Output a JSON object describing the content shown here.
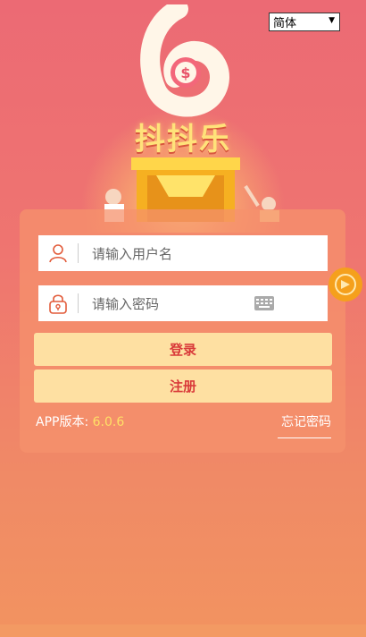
{
  "language_select": {
    "value": "简体"
  },
  "brand": {
    "title": "抖抖乐"
  },
  "login_form": {
    "username_placeholder": "请输入用户名",
    "password_placeholder": "请输入密码",
    "login_label": "登录",
    "register_label": "注册"
  },
  "footer": {
    "version_label": "APP版本:",
    "version_value": "6.0.6",
    "forgot_label": "忘记密码"
  },
  "icons": {
    "user": "user-icon",
    "lock": "lock-icon",
    "keyboard": "keyboard-icon",
    "side_arrow": "arrow-right-icon"
  },
  "colors": {
    "accent": "#fee0a2",
    "button_text": "#d93a3a",
    "icon": "#e25b3a",
    "version_number": "#ffe066"
  }
}
